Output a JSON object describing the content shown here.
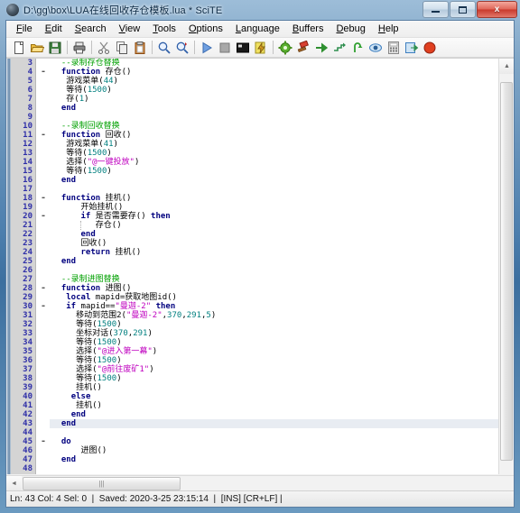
{
  "window": {
    "title": "D:\\gg\\box\\LUA在线回收存仓模板.lua * SciTE",
    "icon": "scite-app-icon",
    "minimize_label": "",
    "maximize_label": "",
    "close_label": "x"
  },
  "menubar": [
    {
      "label": "File",
      "accel": "F"
    },
    {
      "label": "Edit",
      "accel": "E"
    },
    {
      "label": "Search",
      "accel": "S"
    },
    {
      "label": "View",
      "accel": "V"
    },
    {
      "label": "Tools",
      "accel": "T"
    },
    {
      "label": "Options",
      "accel": "O"
    },
    {
      "label": "Language",
      "accel": "L"
    },
    {
      "label": "Buffers",
      "accel": "B"
    },
    {
      "label": "Debug",
      "accel": "D"
    },
    {
      "label": "Help",
      "accel": "H"
    }
  ],
  "toolbar": [
    {
      "name": "new-file-icon",
      "glyph": "page",
      "color": "#ffffff"
    },
    {
      "name": "open-file-icon",
      "glyph": "folder",
      "color": "#e8b84b"
    },
    {
      "name": "save-file-icon",
      "glyph": "floppy",
      "color": "#3f7f3f"
    },
    {
      "name": "separator",
      "glyph": "sep",
      "color": ""
    },
    {
      "name": "print-icon",
      "glyph": "printer",
      "color": "#5a5a5a"
    },
    {
      "name": "separator",
      "glyph": "sep",
      "color": ""
    },
    {
      "name": "cut-icon",
      "glyph": "scissors",
      "color": "#8a8a8a"
    },
    {
      "name": "copy-icon",
      "glyph": "copy",
      "color": "#b9b9b9"
    },
    {
      "name": "paste-icon",
      "glyph": "clipboard",
      "color": "#c96a2e"
    },
    {
      "name": "separator",
      "glyph": "sep",
      "color": ""
    },
    {
      "name": "find-icon",
      "glyph": "magnifier",
      "color": "#2f5fa8"
    },
    {
      "name": "replace-icon",
      "glyph": "magnifier2",
      "color": "#2f5fa8"
    },
    {
      "name": "separator",
      "glyph": "sep",
      "color": ""
    },
    {
      "name": "run-icon",
      "glyph": "play",
      "color": "#3f6fd0"
    },
    {
      "name": "stop-icon",
      "glyph": "stop",
      "color": "#9a9a9a"
    },
    {
      "name": "console-icon",
      "glyph": "console",
      "color": "#2a2a2a"
    },
    {
      "name": "compile-icon",
      "glyph": "lightning",
      "color": "#e0c020"
    },
    {
      "name": "separator",
      "glyph": "sep",
      "color": ""
    },
    {
      "name": "gear-green-icon",
      "glyph": "gear",
      "color": "#4aa020"
    },
    {
      "name": "build-red-icon",
      "glyph": "hammer",
      "color": "#d04020"
    },
    {
      "name": "goto-icon",
      "glyph": "arrow",
      "color": "#30a030"
    },
    {
      "name": "step-icon",
      "glyph": "steps",
      "color": "#2f8f4f"
    },
    {
      "name": "step-out-icon",
      "glyph": "stepout",
      "color": "#30a030"
    },
    {
      "name": "watch-icon",
      "glyph": "eye",
      "color": "#3f7fc0"
    },
    {
      "name": "calculator-icon",
      "glyph": "calc",
      "color": "#c8c8c8"
    },
    {
      "name": "export-icon",
      "glyph": "export",
      "color": "#3f8fc8"
    },
    {
      "name": "record-stop-icon",
      "glyph": "circle",
      "color": "#e04020"
    }
  ],
  "editor": {
    "first_line": 3,
    "current_line": 43,
    "lines": [
      {
        "n": 3,
        "fold": "",
        "tokens": [
          {
            "t": "sp",
            "v": "  "
          },
          {
            "t": "cmt",
            "v": "--录制存仓替换"
          }
        ]
      },
      {
        "n": 4,
        "fold": "-",
        "tokens": [
          {
            "t": "sp",
            "v": "  "
          },
          {
            "t": "kw",
            "v": "function"
          },
          {
            "t": "id",
            "v": " 存仓()"
          }
        ]
      },
      {
        "n": 5,
        "fold": "",
        "tokens": [
          {
            "t": "sp",
            "v": "   "
          },
          {
            "t": "id",
            "v": "游戏菜单("
          },
          {
            "t": "num",
            "v": "44"
          },
          {
            "t": "id",
            "v": ")"
          }
        ]
      },
      {
        "n": 6,
        "fold": "",
        "tokens": [
          {
            "t": "sp",
            "v": "   "
          },
          {
            "t": "id",
            "v": "等待("
          },
          {
            "t": "num",
            "v": "1500"
          },
          {
            "t": "id",
            "v": ")"
          }
        ]
      },
      {
        "n": 7,
        "fold": "",
        "tokens": [
          {
            "t": "sp",
            "v": "   "
          },
          {
            "t": "id",
            "v": "存("
          },
          {
            "t": "num",
            "v": "1"
          },
          {
            "t": "id",
            "v": ")"
          }
        ]
      },
      {
        "n": 8,
        "fold": "",
        "tokens": [
          {
            "t": "sp",
            "v": "  "
          },
          {
            "t": "kw",
            "v": "end"
          }
        ]
      },
      {
        "n": 9,
        "fold": "",
        "tokens": []
      },
      {
        "n": 10,
        "fold": "",
        "tokens": [
          {
            "t": "sp",
            "v": "  "
          },
          {
            "t": "cmt",
            "v": "--录制回收替换"
          }
        ]
      },
      {
        "n": 11,
        "fold": "-",
        "tokens": [
          {
            "t": "sp",
            "v": "  "
          },
          {
            "t": "kw",
            "v": "function"
          },
          {
            "t": "id",
            "v": " 回收()"
          }
        ]
      },
      {
        "n": 12,
        "fold": "",
        "tokens": [
          {
            "t": "sp",
            "v": "   "
          },
          {
            "t": "id",
            "v": "游戏菜单("
          },
          {
            "t": "num",
            "v": "41"
          },
          {
            "t": "id",
            "v": ")"
          }
        ]
      },
      {
        "n": 13,
        "fold": "",
        "tokens": [
          {
            "t": "sp",
            "v": "   "
          },
          {
            "t": "id",
            "v": "等待("
          },
          {
            "t": "num",
            "v": "1500"
          },
          {
            "t": "id",
            "v": ")"
          }
        ]
      },
      {
        "n": 14,
        "fold": "",
        "tokens": [
          {
            "t": "sp",
            "v": "   "
          },
          {
            "t": "id",
            "v": "选择("
          },
          {
            "t": "str",
            "v": "\"@一键投放\""
          },
          {
            "t": "id",
            "v": ")"
          }
        ]
      },
      {
        "n": 15,
        "fold": "",
        "tokens": [
          {
            "t": "sp",
            "v": "   "
          },
          {
            "t": "id",
            "v": "等待("
          },
          {
            "t": "num",
            "v": "1500"
          },
          {
            "t": "id",
            "v": ")"
          }
        ]
      },
      {
        "n": 16,
        "fold": "",
        "tokens": [
          {
            "t": "sp",
            "v": "  "
          },
          {
            "t": "kw",
            "v": "end"
          }
        ]
      },
      {
        "n": 17,
        "fold": "",
        "tokens": []
      },
      {
        "n": 18,
        "fold": "-",
        "tokens": [
          {
            "t": "sp",
            "v": "  "
          },
          {
            "t": "kw",
            "v": "function"
          },
          {
            "t": "id",
            "v": " 挂机()"
          }
        ]
      },
      {
        "n": 19,
        "fold": "",
        "tokens": [
          {
            "t": "sp",
            "v": "      "
          },
          {
            "t": "id",
            "v": "开始挂机()"
          }
        ]
      },
      {
        "n": 20,
        "fold": "-",
        "tokens": [
          {
            "t": "sp",
            "v": "      "
          },
          {
            "t": "kw",
            "v": "if"
          },
          {
            "t": "id",
            "v": " 是否需要存() "
          },
          {
            "t": "kw",
            "v": "then"
          }
        ]
      },
      {
        "n": 21,
        "fold": "",
        "tokens": [
          {
            "t": "sp",
            "v": "         "
          },
          {
            "t": "id",
            "v": "存仓()"
          }
        ],
        "guide": 6
      },
      {
        "n": 22,
        "fold": "",
        "tokens": [
          {
            "t": "sp",
            "v": "      "
          },
          {
            "t": "kw",
            "v": "end"
          }
        ]
      },
      {
        "n": 23,
        "fold": "",
        "tokens": [
          {
            "t": "sp",
            "v": "      "
          },
          {
            "t": "id",
            "v": "回收()"
          }
        ]
      },
      {
        "n": 24,
        "fold": "",
        "tokens": [
          {
            "t": "sp",
            "v": "      "
          },
          {
            "t": "kw",
            "v": "return"
          },
          {
            "t": "id",
            "v": " 挂机()"
          }
        ]
      },
      {
        "n": 25,
        "fold": "",
        "tokens": [
          {
            "t": "sp",
            "v": "  "
          },
          {
            "t": "kw",
            "v": "end"
          }
        ]
      },
      {
        "n": 26,
        "fold": "",
        "tokens": []
      },
      {
        "n": 27,
        "fold": "",
        "tokens": [
          {
            "t": "sp",
            "v": "  "
          },
          {
            "t": "cmt",
            "v": "--录制进图替换"
          }
        ]
      },
      {
        "n": 28,
        "fold": "-",
        "tokens": [
          {
            "t": "sp",
            "v": "  "
          },
          {
            "t": "kw",
            "v": "function"
          },
          {
            "t": "id",
            "v": " 进图()"
          }
        ]
      },
      {
        "n": 29,
        "fold": "",
        "tokens": [
          {
            "t": "sp",
            "v": "   "
          },
          {
            "t": "kw",
            "v": "local"
          },
          {
            "t": "id",
            "v": " mapid=获取地图id()"
          }
        ]
      },
      {
        "n": 30,
        "fold": "-",
        "tokens": [
          {
            "t": "sp",
            "v": "   "
          },
          {
            "t": "kw",
            "v": "if"
          },
          {
            "t": "id",
            "v": " mapid=="
          },
          {
            "t": "str",
            "v": "\"曼迦-2\""
          },
          {
            "t": "id",
            "v": " "
          },
          {
            "t": "kw",
            "v": "then"
          }
        ]
      },
      {
        "n": 31,
        "fold": "",
        "tokens": [
          {
            "t": "sp",
            "v": "     "
          },
          {
            "t": "id",
            "v": "移动到范围2("
          },
          {
            "t": "str",
            "v": "\"曼迦-2\""
          },
          {
            "t": "id",
            "v": ","
          },
          {
            "t": "num",
            "v": "370"
          },
          {
            "t": "id",
            "v": ","
          },
          {
            "t": "num",
            "v": "291"
          },
          {
            "t": "id",
            "v": ","
          },
          {
            "t": "num",
            "v": "5"
          },
          {
            "t": "id",
            "v": ")"
          }
        ]
      },
      {
        "n": 32,
        "fold": "",
        "tokens": [
          {
            "t": "sp",
            "v": "     "
          },
          {
            "t": "id",
            "v": "等待("
          },
          {
            "t": "num",
            "v": "1500"
          },
          {
            "t": "id",
            "v": ")"
          }
        ]
      },
      {
        "n": 33,
        "fold": "",
        "tokens": [
          {
            "t": "sp",
            "v": "     "
          },
          {
            "t": "id",
            "v": "坐标对话("
          },
          {
            "t": "num",
            "v": "370"
          },
          {
            "t": "id",
            "v": ","
          },
          {
            "t": "num",
            "v": "291"
          },
          {
            "t": "id",
            "v": ")"
          }
        ]
      },
      {
        "n": 34,
        "fold": "",
        "tokens": [
          {
            "t": "sp",
            "v": "     "
          },
          {
            "t": "id",
            "v": "等待("
          },
          {
            "t": "num",
            "v": "1500"
          },
          {
            "t": "id",
            "v": ")"
          }
        ]
      },
      {
        "n": 35,
        "fold": "",
        "tokens": [
          {
            "t": "sp",
            "v": "     "
          },
          {
            "t": "id",
            "v": "选择("
          },
          {
            "t": "str",
            "v": "\"@进入第一幕\""
          },
          {
            "t": "id",
            "v": ")"
          }
        ]
      },
      {
        "n": 36,
        "fold": "",
        "tokens": [
          {
            "t": "sp",
            "v": "     "
          },
          {
            "t": "id",
            "v": "等待("
          },
          {
            "t": "num",
            "v": "1500"
          },
          {
            "t": "id",
            "v": ")"
          }
        ]
      },
      {
        "n": 37,
        "fold": "",
        "tokens": [
          {
            "t": "sp",
            "v": "     "
          },
          {
            "t": "id",
            "v": "选择("
          },
          {
            "t": "str",
            "v": "\"@前往废矿1\""
          },
          {
            "t": "id",
            "v": ")"
          }
        ]
      },
      {
        "n": 38,
        "fold": "",
        "tokens": [
          {
            "t": "sp",
            "v": "     "
          },
          {
            "t": "id",
            "v": "等待("
          },
          {
            "t": "num",
            "v": "1500"
          },
          {
            "t": "id",
            "v": ")"
          }
        ]
      },
      {
        "n": 39,
        "fold": "",
        "tokens": [
          {
            "t": "sp",
            "v": "     "
          },
          {
            "t": "id",
            "v": "挂机()"
          }
        ]
      },
      {
        "n": 40,
        "fold": "",
        "tokens": [
          {
            "t": "sp",
            "v": "    "
          },
          {
            "t": "kw",
            "v": "else"
          }
        ]
      },
      {
        "n": 41,
        "fold": "",
        "tokens": [
          {
            "t": "sp",
            "v": "     "
          },
          {
            "t": "id",
            "v": "挂机()"
          }
        ]
      },
      {
        "n": 42,
        "fold": "",
        "tokens": [
          {
            "t": "sp",
            "v": "    "
          },
          {
            "t": "kw",
            "v": "end"
          }
        ]
      },
      {
        "n": 43,
        "fold": "",
        "tokens": [
          {
            "t": "sp",
            "v": "  "
          },
          {
            "t": "kw",
            "v": "end"
          }
        ]
      },
      {
        "n": 44,
        "fold": "",
        "tokens": []
      },
      {
        "n": 45,
        "fold": "-",
        "tokens": [
          {
            "t": "sp",
            "v": "  "
          },
          {
            "t": "kw",
            "v": "do"
          }
        ]
      },
      {
        "n": 46,
        "fold": "",
        "tokens": [
          {
            "t": "sp",
            "v": "      "
          },
          {
            "t": "id",
            "v": "进图()"
          }
        ]
      },
      {
        "n": 47,
        "fold": "",
        "tokens": [
          {
            "t": "sp",
            "v": "  "
          },
          {
            "t": "kw",
            "v": "end"
          }
        ]
      },
      {
        "n": 48,
        "fold": "",
        "tokens": []
      }
    ]
  },
  "scrollbars": {
    "v_up_glyph": "▲",
    "v_down_glyph": "▼",
    "h_left_glyph": "◄",
    "h_right_glyph": "►",
    "h_thumb_glyph": "|||"
  },
  "statusbar": {
    "position": "Ln: 43 Col: 4 Sel: 0",
    "sep1": "  |  ",
    "saved": "Saved: 2020-3-25 23:15:14",
    "sep2": "  |  ",
    "mode": "[INS] [CR+LF] |"
  }
}
